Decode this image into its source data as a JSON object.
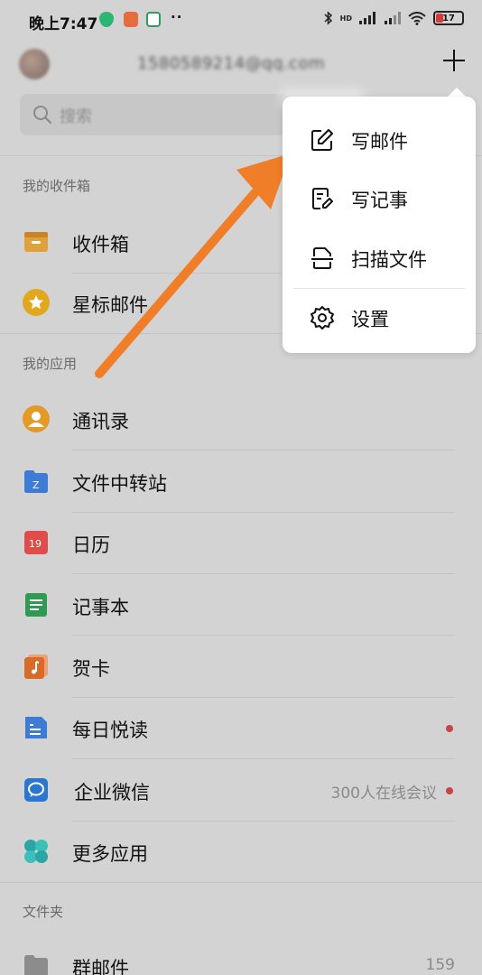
{
  "status_bar": {
    "time": "晚上7:47",
    "dots": "··",
    "net_badge": "HD",
    "battery": "17"
  },
  "header": {
    "email": "1580589214@qq.com",
    "add_icon": "plus-icon"
  },
  "search": {
    "placeholder": "搜索"
  },
  "sections": {
    "inbox_title": "我的收件箱",
    "apps_title": "我的应用",
    "folders_title": "文件夹"
  },
  "inbox_items": [
    {
      "label": "收件箱",
      "icon": "inbox-icon",
      "color": "#e0a13a"
    },
    {
      "label": "星标邮件",
      "icon": "star-icon",
      "color": "#e1a81f"
    }
  ],
  "app_items": [
    {
      "label": "通讯录",
      "icon": "contacts-icon",
      "color": "#e39a28"
    },
    {
      "label": "文件中转站",
      "icon": "file-transfer-icon",
      "color": "#3d7bd6"
    },
    {
      "label": "日历",
      "icon": "calendar-icon",
      "color": "#e04b4b",
      "icon_text": "19"
    },
    {
      "label": "记事本",
      "icon": "notebook-icon",
      "color": "#2e9a52"
    },
    {
      "label": "贺卡",
      "icon": "greeting-card-icon",
      "color": "#d86a2a"
    },
    {
      "label": "每日悦读",
      "icon": "daily-reading-icon",
      "color": "#3d7bd6"
    },
    {
      "label": "企业微信",
      "icon": "wecom-icon",
      "color": "#2a76d0",
      "extra": "300人在线会议"
    },
    {
      "label": "更多应用",
      "icon": "more-apps-icon",
      "color": "#2aa6a6"
    }
  ],
  "folder_items": [
    {
      "label": "群邮件",
      "icon": "folder-icon",
      "count": "159"
    }
  ],
  "popup_menu": [
    {
      "label": "写邮件",
      "icon": "compose-icon"
    },
    {
      "label": "写记事",
      "icon": "note-edit-icon"
    },
    {
      "label": "扫描文件",
      "icon": "scan-icon"
    },
    {
      "label": "设置",
      "icon": "gear-icon"
    }
  ],
  "colors": {
    "annotation_arrow": "#f07d28",
    "unread_dot": "#c44646"
  }
}
